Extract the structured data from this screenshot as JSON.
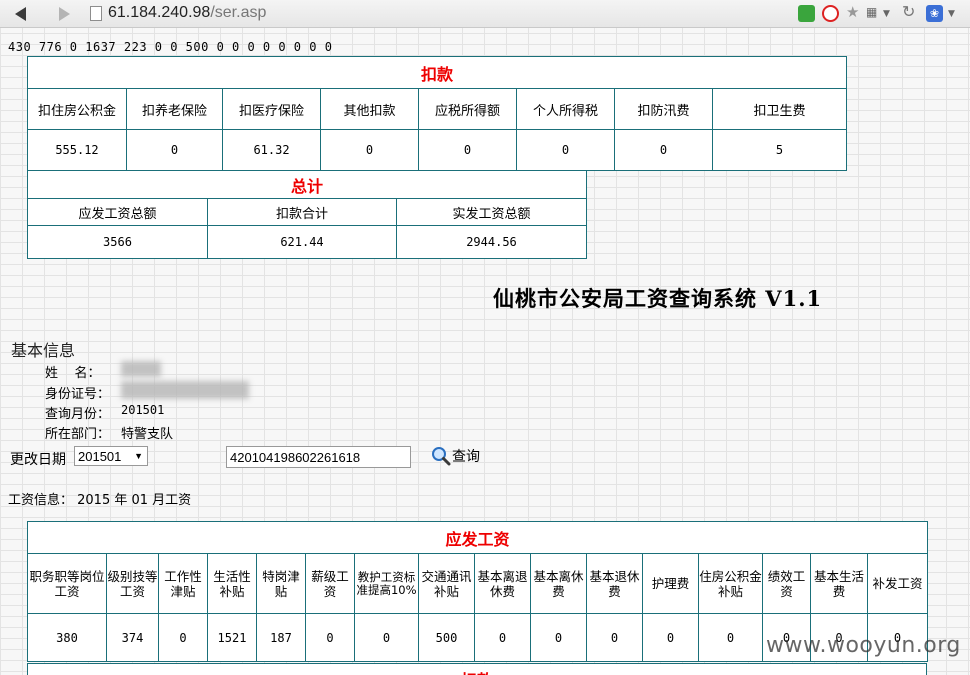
{
  "browser": {
    "url_host": "61.184.240.98",
    "url_path": "/ser.asp"
  },
  "debug_line": "430  776  0  1637  223  0  0  500  0  0  0  0  0  0  0  0",
  "deductions": {
    "title": "扣款",
    "headers": [
      "扣住房公积金",
      "扣养老保险",
      "扣医疗保险",
      "其他扣款",
      "应税所得额",
      "个人所得税",
      "扣防汛费",
      "扣卫生费"
    ],
    "values": [
      "555.12",
      "0",
      "61.32",
      "0",
      "0",
      "0",
      "0",
      "5"
    ]
  },
  "summary": {
    "title": "总计",
    "headers": [
      "应发工资总额",
      "扣款合计",
      "实发工资总额"
    ],
    "values": [
      "3566",
      "621.44",
      "2944.56"
    ]
  },
  "system_title": "仙桃市公安局工资查询系统 V1.1",
  "basic_info": {
    "title": "基本信息",
    "name_label": "姓    名：",
    "id_label": "身份证号：",
    "month_label": "查询月份：",
    "month_value": "201501",
    "dept_label": "所在部门：",
    "dept_value": "特警支队"
  },
  "query": {
    "change_label": "更改日期",
    "selected_month": "201501",
    "id_value": "420104198602261618",
    "button_label": "查询"
  },
  "wage_info": "工资信息： 2015 年 01 月工资",
  "salary": {
    "title": "应发工资",
    "headers": [
      "职务职等岗位工资",
      "级别技等工资",
      "工作性津贴",
      "生活性补贴",
      "特岗津贴",
      "薪级工资",
      "教护工资标准提高10%",
      "交通通讯补贴",
      "基本离退休费",
      "基本离休费",
      "基本退休费",
      "护理费",
      "住房公积金补贴",
      "绩效工资",
      "基本生活费",
      "补发工资"
    ],
    "values": [
      "380",
      "374",
      "0",
      "1521",
      "187",
      "0",
      "0",
      "500",
      "0",
      "0",
      "0",
      "0",
      "0",
      "0",
      "0",
      "0"
    ]
  },
  "deductions_repeat_title": "扣款",
  "watermark": "www.wooyun.org"
}
